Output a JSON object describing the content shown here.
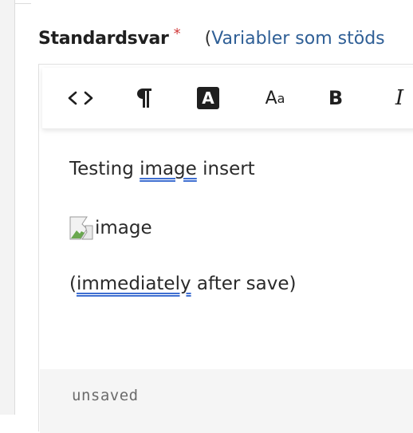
{
  "field": {
    "label": "Standardsvar",
    "required_marker": "*",
    "hint_open": "(",
    "hint_text": "Variabler som stöds"
  },
  "toolbar": {
    "buttons": [
      {
        "name": "source-code",
        "icon": "code-icon"
      },
      {
        "name": "paragraph",
        "icon": "pilcrow-icon"
      },
      {
        "name": "text-color",
        "label": "A"
      },
      {
        "name": "font-size",
        "label_big": "A",
        "label_small": "a"
      },
      {
        "name": "bold",
        "label": "B"
      },
      {
        "name": "italic",
        "label": "I"
      }
    ]
  },
  "content": {
    "line1": {
      "before": "Testing ",
      "spelled": "image",
      "after": " insert"
    },
    "image_alt": "image",
    "line3": {
      "open": "(",
      "spelled": "immediately",
      "after": " after save)"
    }
  },
  "status": {
    "text": "unsaved"
  },
  "colors": {
    "accent": "#2f5f96",
    "required": "#d23b3b",
    "spellcheck": "#3f6fd1",
    "status_bg": "#f5f5f5"
  }
}
